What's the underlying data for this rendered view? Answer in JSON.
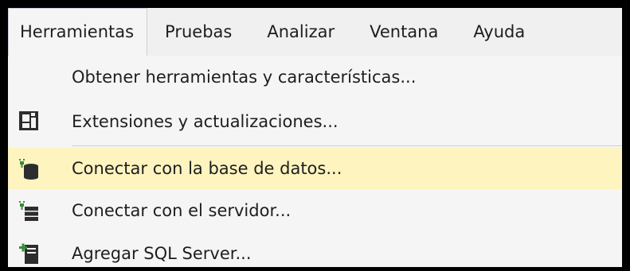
{
  "menubar": {
    "items": [
      {
        "label": "Herramientas"
      },
      {
        "label": "Pruebas"
      },
      {
        "label": "Analizar"
      },
      {
        "label": "Ventana"
      },
      {
        "label": "Ayuda"
      }
    ]
  },
  "dropdown": {
    "items": [
      {
        "label": "Obtener herramientas y características...",
        "icon": "none"
      },
      {
        "label": "Extensiones y actualizaciones...",
        "icon": "extensions-icon"
      },
      {
        "label": "Conectar con la base de datos...",
        "icon": "connect-database-icon"
      },
      {
        "label": "Conectar con el servidor...",
        "icon": "connect-server-icon"
      },
      {
        "label": "Agregar SQL Server...",
        "icon": "add-sql-server-icon"
      }
    ]
  },
  "colors": {
    "highlight": "#fdf4bf",
    "menubar_bg": "#f0f0f0",
    "menu_bg": "#f5f5f5",
    "text": "#1e1e1e",
    "border": "#cccedb",
    "icon_green": "#388a34",
    "icon_dark": "#2d2d30"
  }
}
